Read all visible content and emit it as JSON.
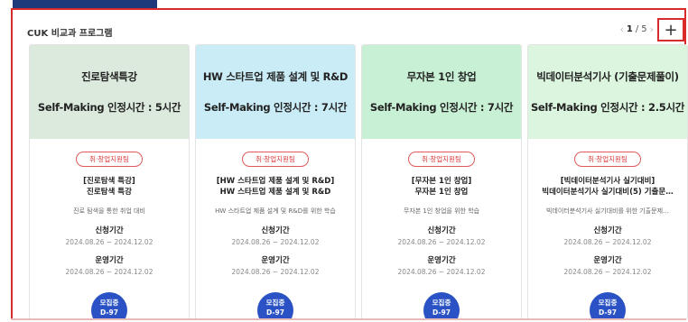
{
  "section_title": "CUK 비교과 프로그램",
  "pager": {
    "current": "1",
    "separator": "/",
    "total": "5",
    "prev": "‹",
    "next": "›"
  },
  "add_button": "+",
  "cards": [
    {
      "thumb_color": "#dbeadd",
      "thumb_title": "진로탐색특강",
      "thumb_sub": "Self-Making 인정시간 : 5시간",
      "badge": "취·창업지원팀",
      "name_line1": "[진로탐색 특강]",
      "name_line2": "진로탐색 특강",
      "desc": "진로 탐색을 통한 취업 대비",
      "apply_label": "신청기간",
      "apply_dates": "2024.08.26 ~ 2024.12.02",
      "run_label": "운영기간",
      "run_dates": "2024.08.26 ~ 2024.12.02",
      "status": "모집중",
      "dday": "D-97"
    },
    {
      "thumb_color": "#c9ecf7",
      "thumb_title": "HW 스타트업 제품 설계 및 R&D",
      "thumb_sub": "Self-Making 인정시간 : 7시간",
      "badge": "취·창업지원팀",
      "name_line1": "[HW 스타트업 제품 설계 및 R&D]",
      "name_line2": "HW 스타트업 제품 설계 및 R&D",
      "desc": "HW 스타트업 제품 설계 및 R&D를 위한 학습",
      "apply_label": "신청기간",
      "apply_dates": "2024.08.26 ~ 2024.12.02",
      "run_label": "운영기간",
      "run_dates": "2024.08.26 ~ 2024.12.02",
      "status": "모집중",
      "dday": "D-97"
    },
    {
      "thumb_color": "#c8f0d4",
      "thumb_title": "무자본 1인 창업",
      "thumb_sub": "Self-Making 인정시간 : 7시간",
      "badge": "취·창업지원팀",
      "name_line1": "[무자본 1인 창업]",
      "name_line2": "무자본 1인 창업",
      "desc": "무자본 1인 창업을 위한 학습",
      "apply_label": "신청기간",
      "apply_dates": "2024.08.26 ~ 2024.12.02",
      "run_label": "운영기간",
      "run_dates": "2024.08.26 ~ 2024.12.02",
      "status": "모집중",
      "dday": "D-97"
    },
    {
      "thumb_color": "#dcf5df",
      "thumb_title": "빅데이터분석기사 (기출문제풀이)",
      "thumb_sub": "Self-Making 인정시간 : 2.5시간",
      "badge": "취·창업지원팀",
      "name_line1": "[빅데이터분석기사 실기대비]",
      "name_line2": "빅데이터분석기사 실기대비(5) 기출문…",
      "desc": "빅데이터분석기사 실기대비를 위한 기출문제…",
      "apply_label": "신청기간",
      "apply_dates": "2024.08.26 ~ 2024.12.02",
      "run_label": "운영기간",
      "run_dates": "2024.08.26 ~ 2024.12.02",
      "status": "모집중",
      "dday": "D-97"
    }
  ]
}
